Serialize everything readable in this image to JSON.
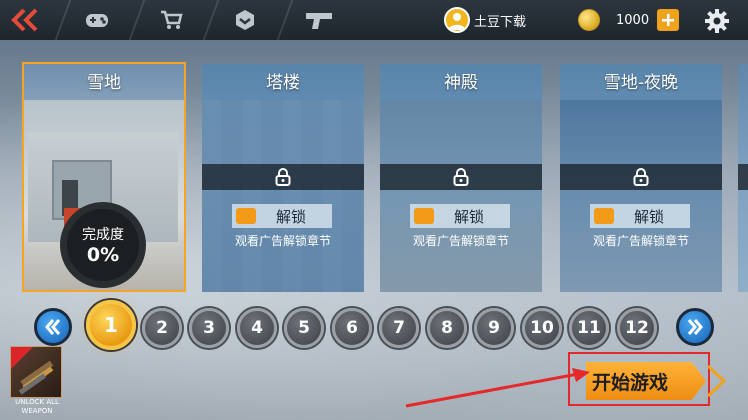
{
  "topbar": {
    "user": {
      "name": "土豆下载"
    },
    "coins": {
      "value": "1000"
    }
  },
  "maps": [
    {
      "title": "雪地",
      "selected": true,
      "progress_label": "完成度",
      "progress_value": "0%"
    },
    {
      "title": "塔楼",
      "locked": true,
      "unlock_label": "解锁",
      "unlock_sub": "观看广告解锁章节"
    },
    {
      "title": "神殿",
      "locked": true,
      "unlock_label": "解锁",
      "unlock_sub": "观看广告解锁章节"
    },
    {
      "title": "雪地-夜晚",
      "locked": true,
      "unlock_label": "解锁",
      "unlock_sub": "观看广告解锁章节"
    }
  ],
  "levels": [
    "1",
    "2",
    "3",
    "4",
    "5",
    "6",
    "7",
    "8",
    "9",
    "10",
    "11",
    "12"
  ],
  "active_level": "1",
  "promo": {
    "label": "UNLOCK ALL WEAPON"
  },
  "start_button": {
    "label": "开始游戏"
  },
  "colors": {
    "accent": "#f3a526",
    "start": "#ef8d12",
    "highlight": "#e5282a"
  }
}
